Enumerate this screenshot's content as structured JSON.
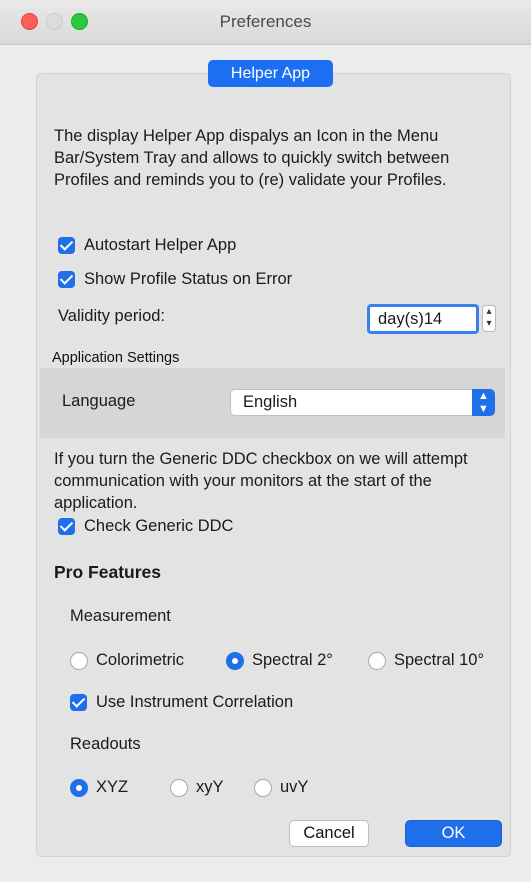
{
  "window": {
    "title": "Preferences"
  },
  "helper": {
    "tab_label": "Helper App",
    "description": "The display Helper App dispalys an Icon in the Menu Bar/System Tray and allows to quickly switch between Profiles and reminds you to (re) validate your Profiles.",
    "autostart_label": "Autostart Helper App",
    "autostart_checked": true,
    "show_status_label": "Show Profile Status on Error",
    "show_status_checked": true,
    "validity_label": "Validity period:",
    "validity_value": "day(s)14"
  },
  "app_settings": {
    "heading": "Application Settings",
    "language_label": "Language",
    "language_value": "English"
  },
  "ddc": {
    "description": "If you turn the Generic DDC checkbox on we will attempt communication with your monitors at the start of the application.",
    "check_label": "Check Generic DDC",
    "checked": true
  },
  "pro": {
    "title": "Pro Features",
    "measurement_label": "Measurement",
    "measurement_options": [
      "Colorimetric",
      "Spectral 2°",
      "Spectral 10°"
    ],
    "measurement_selected": "Spectral 2°",
    "correlation_label": "Use Instrument Correlation",
    "correlation_checked": true,
    "readouts_label": "Readouts",
    "readout_options": [
      "XYZ",
      "xyY",
      "uvY"
    ],
    "readout_selected": "XYZ"
  },
  "buttons": {
    "cancel": "Cancel",
    "ok": "OK"
  },
  "colors": {
    "accent": "#1f6feb",
    "window_bg": "#ececec",
    "close": "#fe5f57",
    "zoom": "#28c840"
  }
}
